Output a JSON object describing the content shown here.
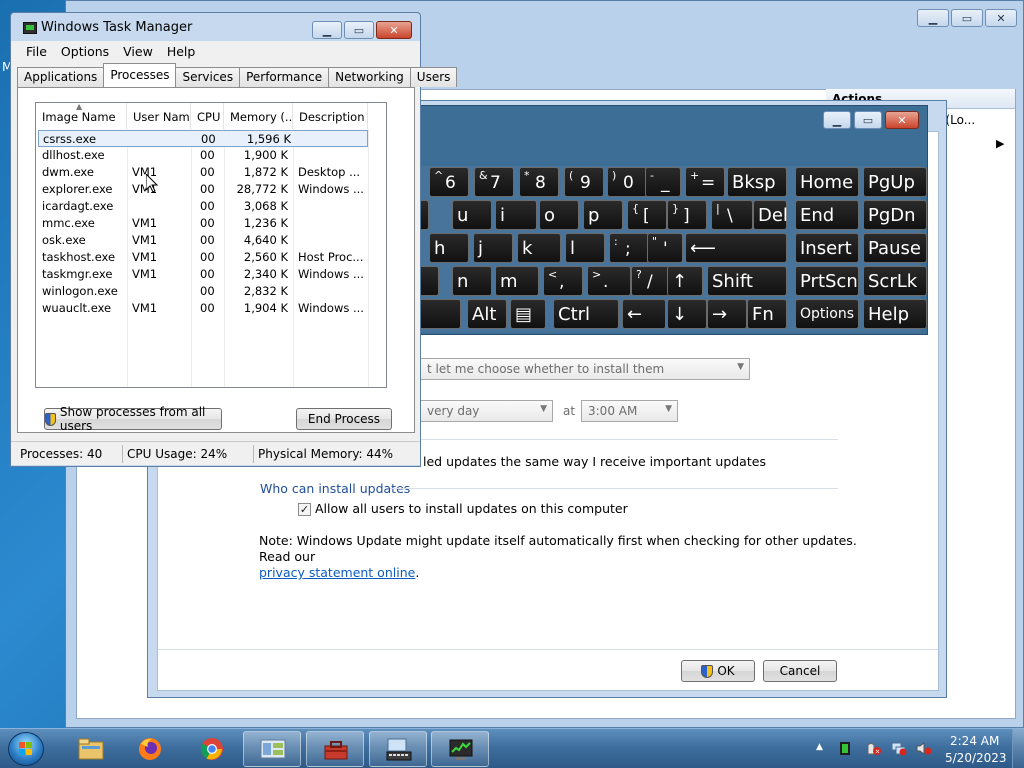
{
  "desktop": {
    "icon_fragment": "M"
  },
  "mmc": {
    "actions_header": "Actions",
    "actions_row": "os (Lo..."
  },
  "settings": {
    "recommended_combo": "t let me choose whether to install them",
    "schedule_day_combo": "very day",
    "schedule_at_label": "at",
    "schedule_time_combo": "3:00 AM",
    "recommended_check_text": "led updates the same way I receive important updates",
    "who_header": "Who can install updates",
    "allow_users_text": "Allow all users to install updates on this computer",
    "allow_users_checked": true,
    "note_text": "Note: Windows Update might update itself automatically first when checking for other updates.  Read our",
    "privacy_link": "privacy statement online",
    "note_end": ".",
    "ok_label": "OK",
    "cancel_label": "Cancel"
  },
  "osk": {
    "rows": [
      [
        {
          "sup": "^",
          "main": "6"
        },
        {
          "sup": "&",
          "main": "7"
        },
        {
          "sup": "*",
          "main": "8"
        },
        {
          "sup": "(",
          "main": "9"
        },
        {
          "sup": ")",
          "main": "0"
        },
        {
          "sup": "-",
          "main": "_"
        },
        {
          "sup": "+",
          "main": "="
        },
        {
          "label": "Bksp"
        },
        {
          "label": "Home"
        },
        {
          "label": "PgUp"
        }
      ],
      [
        {
          "label": ""
        },
        {
          "label": "u"
        },
        {
          "label": "i"
        },
        {
          "label": "o"
        },
        {
          "label": "p"
        },
        {
          "sup": "{",
          "main": "["
        },
        {
          "sup": "}",
          "main": "]"
        },
        {
          "sup": "|",
          "main": "\\"
        },
        {
          "label": "Del"
        },
        {
          "label": "End"
        },
        {
          "label": "PgDn"
        }
      ],
      [
        {
          "label": "h"
        },
        {
          "label": "j"
        },
        {
          "label": "k"
        },
        {
          "label": "l"
        },
        {
          "sup": ":",
          "main": ";"
        },
        {
          "sup": "\"",
          "main": "'"
        },
        {
          "label": "⟵"
        },
        {
          "label": "Insert"
        },
        {
          "label": "Pause"
        }
      ],
      [
        {
          "label": ""
        },
        {
          "label": "n"
        },
        {
          "label": "m"
        },
        {
          "sup": "<",
          "main": ","
        },
        {
          "sup": ">",
          "main": "."
        },
        {
          "sup": "?",
          "main": "/"
        },
        {
          "label": "↑"
        },
        {
          "label": "Shift"
        },
        {
          "label": "PrtScn"
        },
        {
          "label": "ScrLk"
        }
      ],
      [
        {
          "label": ""
        },
        {
          "label": "Alt"
        },
        {
          "label": "▤"
        },
        {
          "label": "Ctrl"
        },
        {
          "label": "←"
        },
        {
          "label": "↓"
        },
        {
          "label": "→"
        },
        {
          "label": "Fn"
        },
        {
          "label": "Options"
        },
        {
          "label": "Help"
        }
      ]
    ]
  },
  "task_manager": {
    "title": "Windows Task Manager",
    "menu": [
      "File",
      "Options",
      "View",
      "Help"
    ],
    "tabs": [
      "Applications",
      "Processes",
      "Services",
      "Performance",
      "Networking",
      "Users"
    ],
    "active_tab": "Processes",
    "columns": [
      "Image Name",
      "User Name",
      "CPU",
      "Memory (...",
      "Description"
    ],
    "processes": [
      {
        "name": "csrss.exe",
        "user": "",
        "cpu": "00",
        "mem": "1,596 K",
        "desc": ""
      },
      {
        "name": "dllhost.exe",
        "user": "",
        "cpu": "00",
        "mem": "1,900 K",
        "desc": ""
      },
      {
        "name": "dwm.exe",
        "user": "VM1",
        "cpu": "00",
        "mem": "1,872 K",
        "desc": "Desktop ..."
      },
      {
        "name": "explorer.exe",
        "user": "VM1",
        "cpu": "00",
        "mem": "28,772 K",
        "desc": "Windows ..."
      },
      {
        "name": "icardagt.exe",
        "user": "",
        "cpu": "00",
        "mem": "3,068 K",
        "desc": ""
      },
      {
        "name": "mmc.exe",
        "user": "VM1",
        "cpu": "00",
        "mem": "1,236 K",
        "desc": ""
      },
      {
        "name": "osk.exe",
        "user": "VM1",
        "cpu": "00",
        "mem": "4,640 K",
        "desc": ""
      },
      {
        "name": "taskhost.exe",
        "user": "VM1",
        "cpu": "00",
        "mem": "2,560 K",
        "desc": "Host Proc..."
      },
      {
        "name": "taskmgr.exe",
        "user": "VM1",
        "cpu": "00",
        "mem": "2,340 K",
        "desc": "Windows ..."
      },
      {
        "name": "winlogon.exe",
        "user": "",
        "cpu": "00",
        "mem": "2,832 K",
        "desc": ""
      },
      {
        "name": "wuauclt.exe",
        "user": "VM1",
        "cpu": "00",
        "mem": "1,904 K",
        "desc": "Windows ..."
      }
    ],
    "show_all_button": "Show processes from all users",
    "end_process_button": "End Process",
    "status": {
      "processes": "Processes: 40",
      "cpu": "CPU Usage: 24%",
      "memory": "Physical Memory: 44%"
    }
  },
  "taskbar": {
    "clock_time": "2:24 AM",
    "clock_date": "5/20/2023",
    "pinned": [
      "explorer-icon",
      "firefox-icon",
      "chrome-icon",
      "mmc-icon",
      "toolbox-icon",
      "osk-icon",
      "taskmgr-icon"
    ]
  },
  "colors": {
    "osk_bg": "#3c6e96",
    "link": "#0b5cc0",
    "header_blue": "#1e4e9a"
  }
}
